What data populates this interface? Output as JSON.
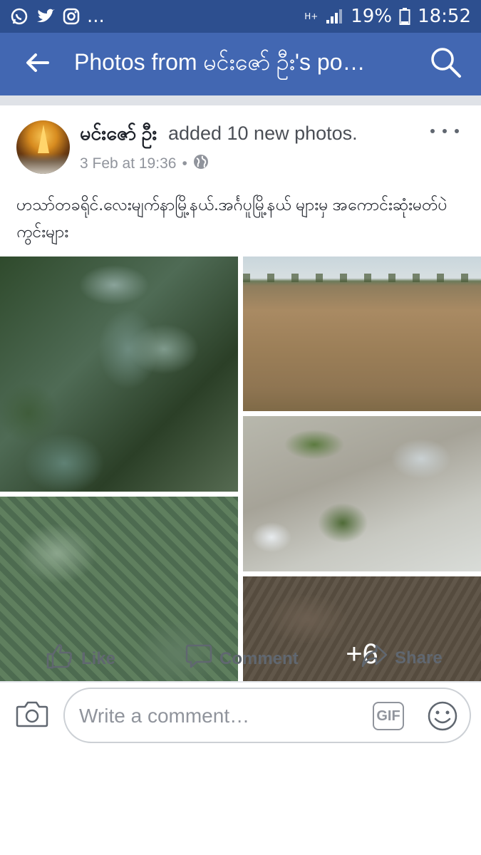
{
  "status_bar": {
    "notification_icons": [
      "whatsapp-icon",
      "twitter-icon",
      "instagram-icon"
    ],
    "more_indicator": "...",
    "network": "H+",
    "battery": "19%",
    "time": "18:52"
  },
  "app_bar": {
    "title": "Photos from မင်းဇော် ဦး's po…",
    "back_icon": "back-arrow-icon",
    "search_icon": "search-icon"
  },
  "post": {
    "author": "မင်းဇော် ဦး",
    "action": "added 10 new photos.",
    "date": "3 Feb at 19:36",
    "separator": "•",
    "privacy_icon": "globe-icon",
    "text": "ဟသာ်တခရိုင်.လေးမျက်နာမြို့နယ်.အင်္ဂပူမြို့နယ် များမှ အကောင်းဆုံးမတ်ပဲကွင်းများ",
    "more_photos": "+6"
  },
  "actions": {
    "like": "Like",
    "comment": "Comment",
    "share": "Share"
  },
  "composer": {
    "placeholder": "Write a comment…",
    "gif_label": "GIF"
  },
  "colors": {
    "app_bar": "#4267b2",
    "status_bar": "#2d4f8f",
    "action_text": "#606770",
    "meta_text": "#90949c"
  }
}
